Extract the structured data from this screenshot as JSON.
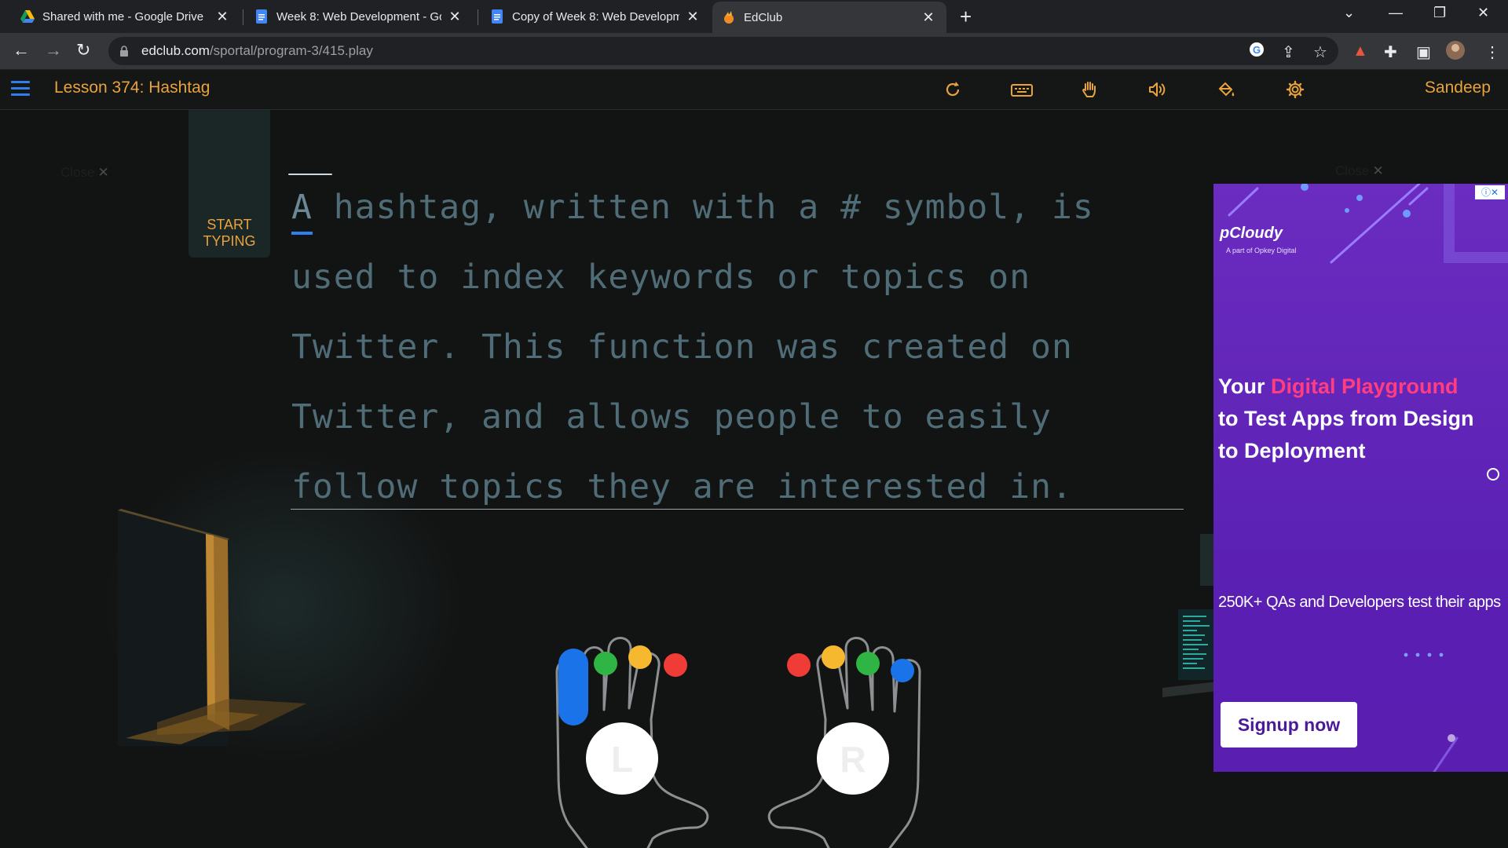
{
  "browser": {
    "tabs": [
      {
        "label": "Shared with me - Google Drive",
        "icon": "google-drive-icon",
        "active": false
      },
      {
        "label": "Week 8: Web Development - Goo",
        "icon": "google-docs-icon",
        "active": false
      },
      {
        "label": "Copy of Week 8: Web Developme",
        "icon": "google-docs-icon",
        "active": false
      },
      {
        "label": "EdClub",
        "icon": "edclub-icon",
        "active": true
      }
    ],
    "url_host": "edclub.com",
    "url_path": "/sportal/program-3/415.play"
  },
  "app": {
    "lesson_title": "Lesson 374: Hashtag",
    "user_name": "Sandeep",
    "toolbar_icons": [
      "restart-icon",
      "keyboard-icon",
      "hand-icon",
      "sound-icon",
      "paint-bucket-icon",
      "settings-icon"
    ],
    "accent_color": "#e8a33c"
  },
  "start_panel": {
    "line1": "START",
    "line2": "TYPING"
  },
  "close_label": "Close",
  "typing": {
    "first_char": "A",
    "lines": [
      " hashtag, written with a # symbol, is",
      "used to index keywords or topics on",
      "Twitter. This function was created on",
      "Twitter, and allows people to easily",
      "follow topics they are interested in."
    ]
  },
  "hands": {
    "left_label": "L",
    "right_label": "R",
    "finger_colors": [
      "#1a73e8",
      "#2fb544",
      "#f5b82e",
      "#ef3c36"
    ]
  },
  "ad": {
    "logo": "pCloudy",
    "logo_sub": "A part of Opkey Digital",
    "headline_pre": "Your ",
    "headline_highlight": "Digital Playground",
    "headline_line2": "to Test Apps from Design",
    "headline_line3": "to Deployment",
    "sub": "250K+ QAs and Developers test their apps",
    "button": "Signup now"
  }
}
